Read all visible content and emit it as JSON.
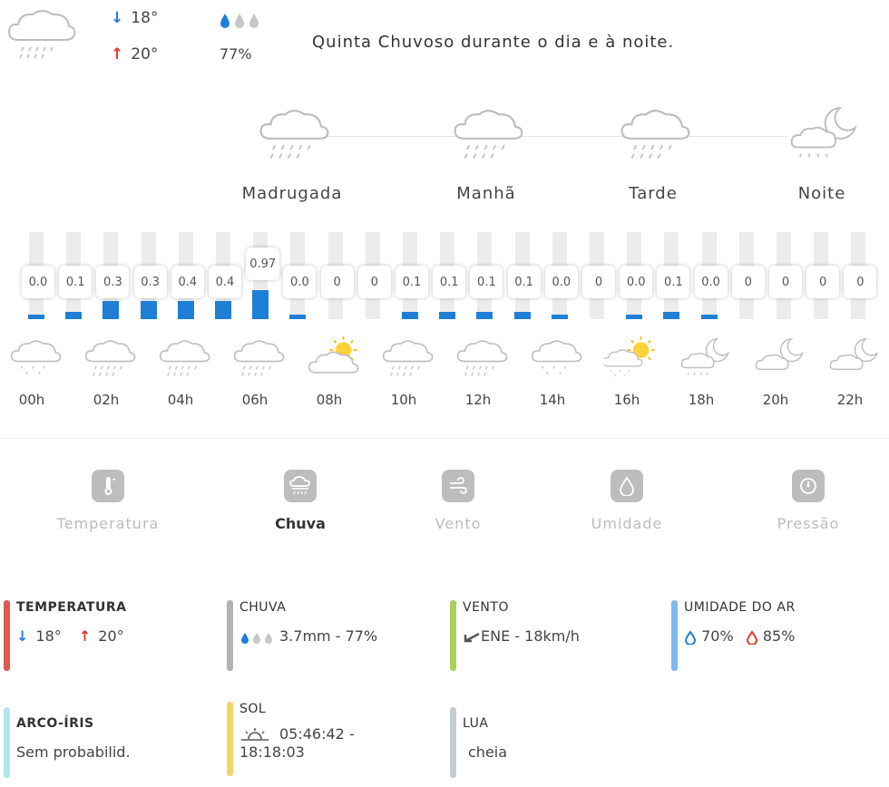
{
  "summary": {
    "min_temp": "18°",
    "max_temp": "20°",
    "rain_prob": "77%",
    "description": "Quinta Chuvoso durante o dia e à noite."
  },
  "periods": [
    {
      "label": "Madrugada",
      "icon": "rain-cloud-icon"
    },
    {
      "label": "Manhã",
      "icon": "rain-cloud-icon"
    },
    {
      "label": "Tarde",
      "icon": "rain-cloud-icon"
    },
    {
      "label": "Noite",
      "icon": "moon-rain-cloud-icon"
    }
  ],
  "hourly_precip": [
    "0.0",
    "0.1",
    "0.3",
    "0.3",
    "0.4",
    "0.4",
    "0.97",
    "0.0",
    "0",
    "0",
    "0.1",
    "0.1",
    "0.1",
    "0.1",
    "0.0",
    "0",
    "0.0",
    "0.1",
    "0.0",
    "0",
    "0",
    "0",
    "0"
  ],
  "hourly_icons": [
    {
      "hour": "00h",
      "icon": "light-rain-cloud-icon"
    },
    {
      "hour": "02h",
      "icon": "rain-cloud-icon"
    },
    {
      "hour": "04h",
      "icon": "rain-cloud-icon"
    },
    {
      "hour": "06h",
      "icon": "rain-cloud-icon"
    },
    {
      "hour": "08h",
      "icon": "sun-cloud-icon"
    },
    {
      "hour": "10h",
      "icon": "rain-cloud-icon"
    },
    {
      "hour": "12h",
      "icon": "rain-cloud-icon"
    },
    {
      "hour": "14h",
      "icon": "light-rain-cloud-icon"
    },
    {
      "hour": "16h",
      "icon": "sun-rain-cloud-icon"
    },
    {
      "hour": "18h",
      "icon": "moon-rain-cloud-icon"
    },
    {
      "hour": "20h",
      "icon": "moon-cloud-icon"
    },
    {
      "hour": "22h",
      "icon": "moon-cloud-icon"
    }
  ],
  "tabs": [
    {
      "label": "Temperatura",
      "icon": "thermometer-icon",
      "active": false
    },
    {
      "label": "Chuva",
      "icon": "rain-icon",
      "active": true
    },
    {
      "label": "Vento",
      "icon": "wind-icon",
      "active": false
    },
    {
      "label": "Umidade",
      "icon": "droplet-icon",
      "active": false
    },
    {
      "label": "Pressão",
      "icon": "gauge-icon",
      "active": false
    }
  ],
  "stats": {
    "temperatura": {
      "title": "TEMPERATURA",
      "min": "18°",
      "max": "20°",
      "color": "#e05a4f"
    },
    "chuva": {
      "title": "CHUVA",
      "value": "3.7mm - 77%",
      "color": "#b3b3b3"
    },
    "vento": {
      "title": "VENTO",
      "value": "ENE - 18km/h",
      "color": "#a9d05b"
    },
    "umidade": {
      "title": "UMIDADE DO AR",
      "min": "70%",
      "max": "85%",
      "color": "#7db8ef"
    },
    "arco_iris": {
      "title": "ARCO-ÍRIS",
      "value": "Sem probabilid.",
      "color": "#aee8ec"
    },
    "sol": {
      "title": "SOL",
      "value": "05:46:42 - 18:18:03",
      "color": "#f5d36b"
    },
    "lua": {
      "title": "LUA",
      "value": "cheia",
      "color": "#c4cdd3"
    }
  },
  "colors": {
    "bar": "#1e7fd6",
    "down_arrow": "#1e7fd6",
    "up_arrow": "#e23a2d"
  }
}
